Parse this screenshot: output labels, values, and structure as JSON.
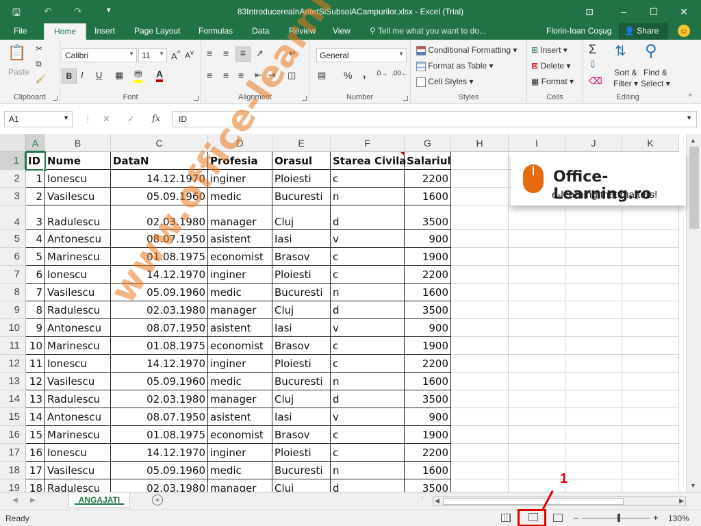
{
  "window": {
    "title": "83IntroducereaInAntetSiSubsolACampurilor.xlsx - Excel (Trial)",
    "controls": [
      "⊡",
      "–",
      "☐",
      "✕"
    ]
  },
  "quick_access": {
    "save_icon": "save-icon",
    "undo_icon": "undo-icon",
    "redo_icon": "redo-icon"
  },
  "ribbon_tabs": [
    "File",
    "Home",
    "Insert",
    "Page Layout",
    "Formulas",
    "Data",
    "Review",
    "View"
  ],
  "tell_me": "Tell me what you want to do...",
  "user": "Florin-Ioan Coşug",
  "share": "Share",
  "ribbon": {
    "clipboard": {
      "label": "Clipboard",
      "paste": "Paste"
    },
    "font": {
      "label": "Font",
      "name": "Calibri",
      "size": "11",
      "bold": "B",
      "italic": "I",
      "underline": "U"
    },
    "alignment": {
      "label": "Alignment"
    },
    "number": {
      "label": "Number",
      "format": "General",
      "percent": "%",
      "comma": ","
    },
    "styles": {
      "label": "Styles",
      "items": [
        "Conditional Formatting",
        "Format as Table",
        "Cell Styles"
      ]
    },
    "cells": {
      "label": "Cells",
      "items": [
        "Insert",
        "Delete",
        "Format"
      ]
    },
    "editing": {
      "label": "Editing",
      "sort_filter_1": "Sort &",
      "sort_filter_2": "Filter",
      "find_select_1": "Find &",
      "find_select_2": "Select"
    }
  },
  "formula_bar": {
    "name_box": "A1",
    "fx": "fx",
    "formula": "ID"
  },
  "columns": [
    "A",
    "B",
    "C",
    "D",
    "E",
    "F",
    "G",
    "H",
    "I",
    "J",
    "K"
  ],
  "table": {
    "headers": [
      "ID",
      "Nume",
      "DataN",
      "Profesia",
      "Orasul",
      "Starea Civila",
      "Salariul"
    ],
    "rows": [
      [
        "1",
        "Ionescu",
        "14.12.1970",
        "inginer",
        "Ploiesti",
        "c",
        "2200"
      ],
      [
        "2",
        "Vasilescu",
        "05.09.1960",
        "medic",
        "Bucuresti",
        "n",
        "1600"
      ],
      [
        "3",
        "Radulescu",
        "02.03.1980",
        "manager",
        "Cluj",
        "d",
        "3500"
      ],
      [
        "4",
        "Antonescu",
        "08.07.1950",
        "asistent",
        "Iasi",
        "v",
        "900"
      ],
      [
        "5",
        "Marinescu",
        "01.08.1975",
        "economist",
        "Brasov",
        "c",
        "1900"
      ],
      [
        "6",
        "Ionescu",
        "14.12.1970",
        "inginer",
        "Ploiesti",
        "c",
        "2200"
      ],
      [
        "7",
        "Vasilescu",
        "05.09.1960",
        "medic",
        "Bucuresti",
        "n",
        "1600"
      ],
      [
        "8",
        "Radulescu",
        "02.03.1980",
        "manager",
        "Cluj",
        "d",
        "3500"
      ],
      [
        "9",
        "Antonescu",
        "08.07.1950",
        "asistent",
        "Iasi",
        "v",
        "900"
      ],
      [
        "10",
        "Marinescu",
        "01.08.1975",
        "economist",
        "Brasov",
        "c",
        "1900"
      ],
      [
        "11",
        "Ionescu",
        "14.12.1970",
        "inginer",
        "Ploiesti",
        "c",
        "2200"
      ],
      [
        "12",
        "Vasilescu",
        "05.09.1960",
        "medic",
        "Bucuresti",
        "n",
        "1600"
      ],
      [
        "13",
        "Radulescu",
        "02.03.1980",
        "manager",
        "Cluj",
        "d",
        "3500"
      ],
      [
        "14",
        "Antonescu",
        "08.07.1950",
        "asistent",
        "Iasi",
        "v",
        "900"
      ],
      [
        "15",
        "Marinescu",
        "01.08.1975",
        "economist",
        "Brasov",
        "c",
        "1900"
      ],
      [
        "16",
        "Ionescu",
        "14.12.1970",
        "inginer",
        "Ploiesti",
        "c",
        "2200"
      ],
      [
        "17",
        "Vasilescu",
        "05.09.1960",
        "medic",
        "Bucuresti",
        "n",
        "1600"
      ],
      [
        "18",
        "Radulescu",
        "02.03.1980",
        "manager",
        "Cluj",
        "d",
        "3500"
      ]
    ]
  },
  "logo": {
    "brand": "Office-Learning.ro",
    "tagline": "e-learning that matters!"
  },
  "watermark": "www.office-learning.ro",
  "sheet_tab": "ANGAJATI",
  "status": {
    "ready": "Ready",
    "zoom": "130%"
  },
  "annotation": "1",
  "colors": {
    "accent": "#217346",
    "highlight": "#e00000",
    "watermark": "#e8781e"
  }
}
